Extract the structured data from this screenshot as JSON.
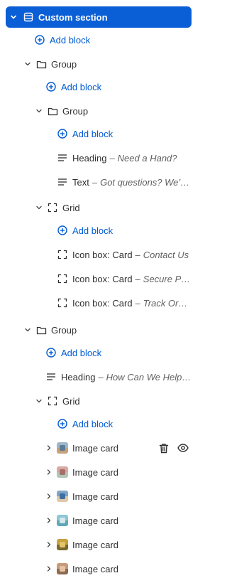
{
  "section": {
    "label": "Custom section"
  },
  "add_block_label": "Add block",
  "items": [
    {
      "kind": "group",
      "label": "Group"
    },
    {
      "kind": "group",
      "label": "Group"
    },
    {
      "kind": "text",
      "label": "Heading",
      "meta": "Need a Hand?"
    },
    {
      "kind": "text",
      "label": "Text",
      "meta": "Got questions? We’v..."
    },
    {
      "kind": "grid",
      "label": "Grid"
    },
    {
      "kind": "iconbox",
      "label": "Icon box: Card",
      "meta": "Contact Us"
    },
    {
      "kind": "iconbox",
      "label": "Icon box: Card",
      "meta": "Secure Pa..."
    },
    {
      "kind": "iconbox",
      "label": "Icon box: Card",
      "meta": "Track Order"
    },
    {
      "kind": "group",
      "label": "Group"
    },
    {
      "kind": "text",
      "label": "Heading",
      "meta": "How Can We Help ..."
    },
    {
      "kind": "grid",
      "label": "Grid"
    }
  ],
  "image_cards": [
    {
      "label": "Image card"
    },
    {
      "label": "Image card"
    },
    {
      "label": "Image card"
    },
    {
      "label": "Image card"
    },
    {
      "label": "Image card"
    },
    {
      "label": "Image card"
    }
  ],
  "icons": {
    "section": "section-icon",
    "add": "plus-circle-icon",
    "group": "folder-icon",
    "text": "text-lines-icon",
    "grid": "grid-frame-icon",
    "chevron_down": "chevron-down-icon",
    "chevron_right": "chevron-right-icon",
    "delete": "trash-icon",
    "visibility": "eye-icon"
  },
  "colors": {
    "accent": "#0b5fd6",
    "link": "#005bd3",
    "text": "#303030",
    "muted": "#616161"
  }
}
